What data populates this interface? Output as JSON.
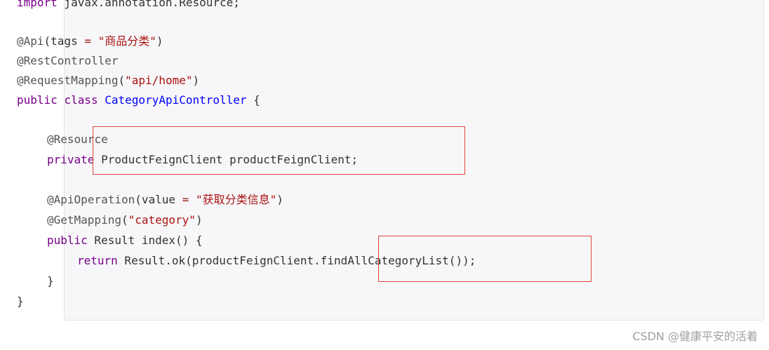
{
  "code": {
    "line1": {
      "kw": "import",
      "rest": " javax.annotation.Resource;"
    },
    "line2": {
      "ann": "@Api",
      "p1": "(tags ",
      "op": "=",
      "sp": " ",
      "str": "\"商品分类\"",
      "p2": ")"
    },
    "line3": {
      "ann": "@RestController"
    },
    "line4": {
      "ann": "@RequestMapping",
      "p1": "(",
      "str": "\"api/home\"",
      "p2": ")"
    },
    "line5": {
      "kw1": "public",
      "kw2": "class",
      "cls": "CategoryApiController",
      "rest": " {"
    },
    "line6": {
      "ann": "@Resource"
    },
    "line7": {
      "kw": "private",
      "rest": " ProductFeignClient productFeignClient;"
    },
    "line8": {
      "ann": "@ApiOperation",
      "p1": "(value ",
      "op": "=",
      "sp": " ",
      "str": "\"获取分类信息\"",
      "p2": ")"
    },
    "line9": {
      "ann": "@GetMapping",
      "p1": "(",
      "str": "\"category\"",
      "p2": ")"
    },
    "line10": {
      "kw": "public",
      "rest": " Result index() {"
    },
    "line11": {
      "kw": "return",
      "rest": " Result.ok(productFeignClient.findAllCategoryList());"
    },
    "line12": {
      "text": "}"
    },
    "line13": {
      "text": "}"
    }
  },
  "watermark": "CSDN @健康平安的活着",
  "colors": {
    "keyword": "#770088",
    "annotation": "#555555",
    "string": "#aa1111",
    "class_name": "#0000ff",
    "highlight_border": "#e0453a",
    "code_background": "#f7f7f9"
  }
}
